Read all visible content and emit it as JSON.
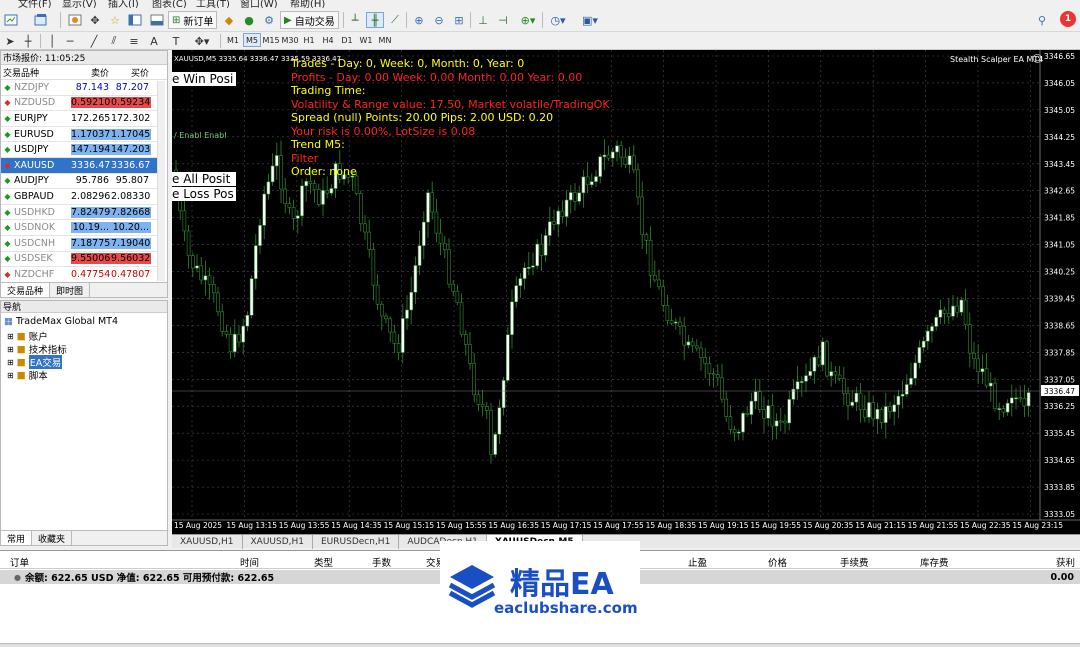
{
  "menu": [
    "文件(F)",
    "显示(V)",
    "插入(I)",
    "图表(C)",
    "工具(T)",
    "窗口(W)",
    "帮助(H)"
  ],
  "toolbar": {
    "new_order": "新订单",
    "auto_trading": "自动交易"
  },
  "timeframes": [
    "M1",
    "M5",
    "M15",
    "M30",
    "H1",
    "H4",
    "D1",
    "W1",
    "MN"
  ],
  "active_tf": "M5",
  "market_watch": {
    "title": "市场报价: 11:05:25",
    "headers": [
      "交易品种",
      "卖价",
      "买价"
    ],
    "rows": [
      {
        "sym": "NZDJPY",
        "bid": "87.143",
        "ask": "87.207",
        "dir": "up",
        "bg": "#ffffff",
        "col": "#0000cc"
      },
      {
        "sym": "NZDUSD",
        "bid": "0.59210",
        "ask": "0.59234",
        "dir": "down",
        "bg": "#e84a4a",
        "col": "#000000"
      },
      {
        "sym": "EURJPY",
        "bid": "172.265",
        "ask": "172.302",
        "dir": "up",
        "bg": "#ffffff",
        "col": "#000000"
      },
      {
        "sym": "EURUSD",
        "bid": "1.17037",
        "ask": "1.17045",
        "dir": "up",
        "bg": "#7fb2f0",
        "col": "#000000"
      },
      {
        "sym": "USDJPY",
        "bid": "147.194",
        "ask": "147.203",
        "dir": "up",
        "bg": "#7fb2f0",
        "col": "#000000"
      },
      {
        "sym": "XAUUSD",
        "bid": "3336.47",
        "ask": "3336.67",
        "dir": "down",
        "bg": "#3173c8",
        "col": "#ffffff"
      },
      {
        "sym": "AUDJPY",
        "bid": "95.786",
        "ask": "95.807",
        "dir": "up",
        "bg": "#ffffff",
        "col": "#000000"
      },
      {
        "sym": "GBPAUD",
        "bid": "2.08296",
        "ask": "2.08330",
        "dir": "up",
        "bg": "#ffffff",
        "col": "#000000"
      },
      {
        "sym": "USDHKD",
        "bid": "7.82479",
        "ask": "7.82668",
        "dir": "up",
        "bg": "#7fb2f0",
        "col": "#000000"
      },
      {
        "sym": "USDNOK",
        "bid": "10.19...",
        "ask": "10.20...",
        "dir": "up",
        "bg": "#7fb2f0",
        "col": "#000000"
      },
      {
        "sym": "USDCNH",
        "bid": "7.18775",
        "ask": "7.19040",
        "dir": "up",
        "bg": "#7fb2f0",
        "col": "#000000"
      },
      {
        "sym": "USDSEK",
        "bid": "9.55006",
        "ask": "9.56032",
        "dir": "up",
        "bg": "#e84a4a",
        "col": "#000000"
      },
      {
        "sym": "NZDCHF",
        "bid": "0.47754",
        "ask": "0.47807",
        "dir": "down",
        "bg": "#ffffff",
        "col": "#cc0000"
      }
    ],
    "tabs": [
      "交易品种",
      "即时图"
    ]
  },
  "navigator": {
    "title": "导航",
    "root": "TradeMax Global MT4",
    "items": [
      "账户",
      "技术指标",
      "EA交易",
      "脚本"
    ],
    "tabs": [
      "常用",
      "收藏夹"
    ]
  },
  "chart": {
    "header": "XAUUSD,M5  3335.64 3336.47 3335.59 3336.47",
    "ea_name": "Stealth Scalper EA MT4",
    "current_price": "3336.47",
    "y_labels": [
      "3346.65",
      "3346.05",
      "3345.05",
      "3344.25",
      "3343.45",
      "3342.65",
      "3341.85",
      "3341.05",
      "3340.25",
      "3339.45",
      "3338.65",
      "3337.85",
      "3337.05",
      "3336.25",
      "3335.45",
      "3334.65",
      "3333.85",
      "3333.05"
    ],
    "x_labels": [
      "15 Aug 2025",
      "15 Aug 13:15",
      "15 Aug 13:55",
      "15 Aug 14:35",
      "15 Aug 15:15",
      "15 Aug 15:55",
      "15 Aug 16:35",
      "15 Aug 17:15",
      "15 Aug 17:55",
      "15 Aug 18:35",
      "15 Aug 19:15",
      "15 Aug 19:55",
      "15 Aug 20:35",
      "15 Aug 21:15",
      "15 Aug 21:55",
      "15 Aug 22:35",
      "15 Aug 23:15"
    ],
    "overlay": [
      {
        "text": "Trades - Day: 0, Week: 0, Month: 0, Year: 0",
        "color": "#ffff00"
      },
      {
        "text": "Profits - Day: 0.00 Week: 0.00 Month: 0.00 Year: 0.00",
        "color": "#ff2020"
      },
      {
        "text": "Trading Time:",
        "color": "#ffff00"
      },
      {
        "text": "Volatility & Range value: 17.50,  Market volatile/TradingOK",
        "color": "#ff2020"
      },
      {
        "text": "Spread (null)  Points: 20.00  Pips: 2.00  USD: 0.20",
        "color": "#ffff00"
      },
      {
        "text": "Your risk is 0.00%, LotSize is 0.08",
        "color": "#ff2020"
      },
      {
        "text": "Trend M5:",
        "color": "#ffff00"
      },
      {
        "text": "Filter",
        "color": "#ff2020"
      },
      {
        "text": "Order: none",
        "color": "#ffff00"
      }
    ],
    "buttons": [
      "e Win Posi",
      "e All Posit",
      "e Loss Pos"
    ],
    "small_btn": "/ Enabl  Enabl"
  },
  "chart_tabs": [
    "XAUUSD,H1",
    "XAUUSD,H1",
    "EURUSDecn,H1",
    "AUDCADecn,H1",
    "XAUUSDecn,M5"
  ],
  "active_chart_tab": "XAUUSDecn,M5",
  "terminal": {
    "headers": [
      "订单",
      "时间",
      "类型",
      "手数",
      "交易",
      "止盈",
      "价格",
      "手续费",
      "库存费",
      "获利"
    ],
    "balance_text": "余额: 622.65 USD  净值: 622.65  可用预付款: 622.65",
    "profit": "0.00"
  },
  "watermark": {
    "title": "精品EA",
    "url": "eaclubshare.com",
    "color": "#1a4fc4"
  }
}
